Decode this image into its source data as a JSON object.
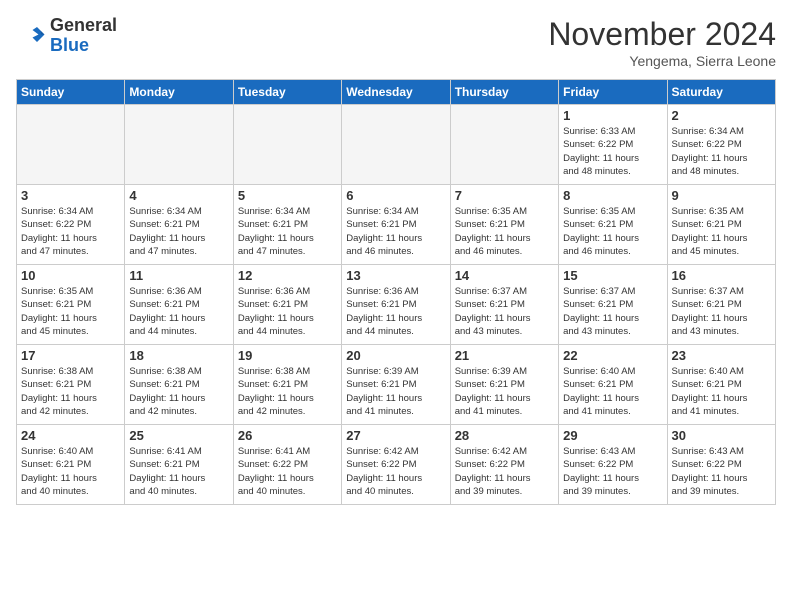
{
  "header": {
    "logo_line1": "General",
    "logo_line2": "Blue",
    "month_title": "November 2024",
    "location": "Yengema, Sierra Leone"
  },
  "weekdays": [
    "Sunday",
    "Monday",
    "Tuesday",
    "Wednesday",
    "Thursday",
    "Friday",
    "Saturday"
  ],
  "weeks": [
    [
      {
        "day": "",
        "detail": ""
      },
      {
        "day": "",
        "detail": ""
      },
      {
        "day": "",
        "detail": ""
      },
      {
        "day": "",
        "detail": ""
      },
      {
        "day": "",
        "detail": ""
      },
      {
        "day": "1",
        "detail": "Sunrise: 6:33 AM\nSunset: 6:22 PM\nDaylight: 11 hours\nand 48 minutes."
      },
      {
        "day": "2",
        "detail": "Sunrise: 6:34 AM\nSunset: 6:22 PM\nDaylight: 11 hours\nand 48 minutes."
      }
    ],
    [
      {
        "day": "3",
        "detail": "Sunrise: 6:34 AM\nSunset: 6:22 PM\nDaylight: 11 hours\nand 47 minutes."
      },
      {
        "day": "4",
        "detail": "Sunrise: 6:34 AM\nSunset: 6:21 PM\nDaylight: 11 hours\nand 47 minutes."
      },
      {
        "day": "5",
        "detail": "Sunrise: 6:34 AM\nSunset: 6:21 PM\nDaylight: 11 hours\nand 47 minutes."
      },
      {
        "day": "6",
        "detail": "Sunrise: 6:34 AM\nSunset: 6:21 PM\nDaylight: 11 hours\nand 46 minutes."
      },
      {
        "day": "7",
        "detail": "Sunrise: 6:35 AM\nSunset: 6:21 PM\nDaylight: 11 hours\nand 46 minutes."
      },
      {
        "day": "8",
        "detail": "Sunrise: 6:35 AM\nSunset: 6:21 PM\nDaylight: 11 hours\nand 46 minutes."
      },
      {
        "day": "9",
        "detail": "Sunrise: 6:35 AM\nSunset: 6:21 PM\nDaylight: 11 hours\nand 45 minutes."
      }
    ],
    [
      {
        "day": "10",
        "detail": "Sunrise: 6:35 AM\nSunset: 6:21 PM\nDaylight: 11 hours\nand 45 minutes."
      },
      {
        "day": "11",
        "detail": "Sunrise: 6:36 AM\nSunset: 6:21 PM\nDaylight: 11 hours\nand 44 minutes."
      },
      {
        "day": "12",
        "detail": "Sunrise: 6:36 AM\nSunset: 6:21 PM\nDaylight: 11 hours\nand 44 minutes."
      },
      {
        "day": "13",
        "detail": "Sunrise: 6:36 AM\nSunset: 6:21 PM\nDaylight: 11 hours\nand 44 minutes."
      },
      {
        "day": "14",
        "detail": "Sunrise: 6:37 AM\nSunset: 6:21 PM\nDaylight: 11 hours\nand 43 minutes."
      },
      {
        "day": "15",
        "detail": "Sunrise: 6:37 AM\nSunset: 6:21 PM\nDaylight: 11 hours\nand 43 minutes."
      },
      {
        "day": "16",
        "detail": "Sunrise: 6:37 AM\nSunset: 6:21 PM\nDaylight: 11 hours\nand 43 minutes."
      }
    ],
    [
      {
        "day": "17",
        "detail": "Sunrise: 6:38 AM\nSunset: 6:21 PM\nDaylight: 11 hours\nand 42 minutes."
      },
      {
        "day": "18",
        "detail": "Sunrise: 6:38 AM\nSunset: 6:21 PM\nDaylight: 11 hours\nand 42 minutes."
      },
      {
        "day": "19",
        "detail": "Sunrise: 6:38 AM\nSunset: 6:21 PM\nDaylight: 11 hours\nand 42 minutes."
      },
      {
        "day": "20",
        "detail": "Sunrise: 6:39 AM\nSunset: 6:21 PM\nDaylight: 11 hours\nand 41 minutes."
      },
      {
        "day": "21",
        "detail": "Sunrise: 6:39 AM\nSunset: 6:21 PM\nDaylight: 11 hours\nand 41 minutes."
      },
      {
        "day": "22",
        "detail": "Sunrise: 6:40 AM\nSunset: 6:21 PM\nDaylight: 11 hours\nand 41 minutes."
      },
      {
        "day": "23",
        "detail": "Sunrise: 6:40 AM\nSunset: 6:21 PM\nDaylight: 11 hours\nand 41 minutes."
      }
    ],
    [
      {
        "day": "24",
        "detail": "Sunrise: 6:40 AM\nSunset: 6:21 PM\nDaylight: 11 hours\nand 40 minutes."
      },
      {
        "day": "25",
        "detail": "Sunrise: 6:41 AM\nSunset: 6:21 PM\nDaylight: 11 hours\nand 40 minutes."
      },
      {
        "day": "26",
        "detail": "Sunrise: 6:41 AM\nSunset: 6:22 PM\nDaylight: 11 hours\nand 40 minutes."
      },
      {
        "day": "27",
        "detail": "Sunrise: 6:42 AM\nSunset: 6:22 PM\nDaylight: 11 hours\nand 40 minutes."
      },
      {
        "day": "28",
        "detail": "Sunrise: 6:42 AM\nSunset: 6:22 PM\nDaylight: 11 hours\nand 39 minutes."
      },
      {
        "day": "29",
        "detail": "Sunrise: 6:43 AM\nSunset: 6:22 PM\nDaylight: 11 hours\nand 39 minutes."
      },
      {
        "day": "30",
        "detail": "Sunrise: 6:43 AM\nSunset: 6:22 PM\nDaylight: 11 hours\nand 39 minutes."
      }
    ]
  ]
}
